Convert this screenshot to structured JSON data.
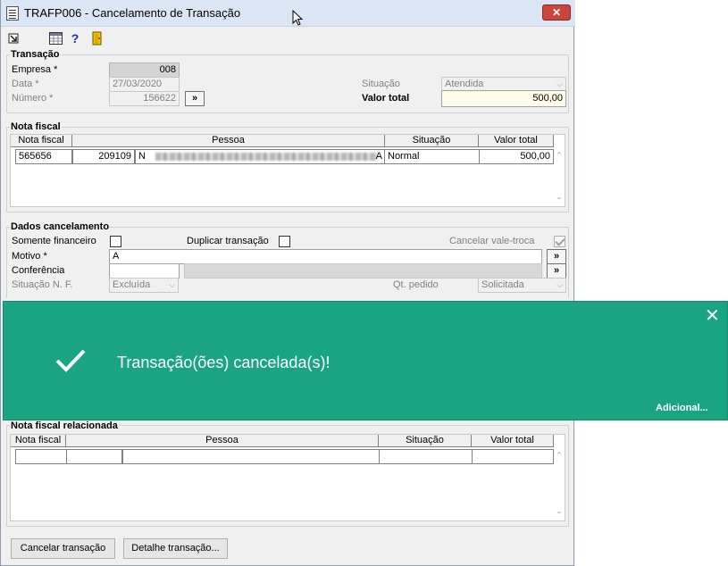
{
  "window": {
    "title": "TRAFP006 - Cancelamento de Transação",
    "close_glyph": "✕"
  },
  "toolbar": {
    "icons": [
      "arrow-out-icon",
      "calculator-icon",
      "help-icon",
      "exit-door-icon"
    ],
    "help_glyph": "?"
  },
  "transacao": {
    "section_title": "Transação",
    "empresa_label": "Empresa *",
    "empresa_value": "008",
    "data_label": "Data *",
    "data_value": "27/03/2020",
    "numero_label": "Número *",
    "numero_value": "156622",
    "search_glyph": "»",
    "situacao_label": "Situação",
    "situacao_value": "Atendida",
    "valor_total_label": "Valor total",
    "valor_total_value": "500,00"
  },
  "nota_fiscal": {
    "section_title": "Nota fiscal",
    "columns": [
      "Nota fiscal",
      "Pessoa",
      "Situação",
      "Valor total"
    ],
    "rows": [
      {
        "nota": "565656",
        "pessoa_code": "209109",
        "pessoa_prefix": "N",
        "pessoa_suffix": "A",
        "situacao": "Normal",
        "valor": "500,00"
      }
    ]
  },
  "dados_cancelamento": {
    "section_title": "Dados cancelamento",
    "somente_financeiro_label": "Somente financeiro",
    "duplicar_label": "Duplicar transação",
    "cancelar_vale_label": "Cancelar vale-troca",
    "motivo_label": "Motivo *",
    "motivo_value": "A",
    "conferencia_label": "Conferência",
    "conferencia_value": "",
    "situacao_nf_label": "Situação N. F.",
    "situacao_nf_value": "Excluída",
    "qt_pedido_label": "Qt. pedido",
    "qt_pedido_value": "Solicitada",
    "search_glyph": "»"
  },
  "nota_relacionada": {
    "section_title": "Nota fiscal relacionada",
    "columns": [
      "Nota fiscal",
      "Pessoa",
      "Situação",
      "Valor total"
    ]
  },
  "buttons": {
    "cancelar": "Cancelar transação",
    "detalhe": "Detalhe transação..."
  },
  "toast": {
    "message": "Transação(ões) cancelada(s)!",
    "more_link": "Adicional...",
    "close_glyph": "✕",
    "background": "#1aa482"
  },
  "colors": {
    "title_bar": "#dbe6f4",
    "close_red": "#c9463d",
    "valor_total_bg": "#fffde8"
  }
}
